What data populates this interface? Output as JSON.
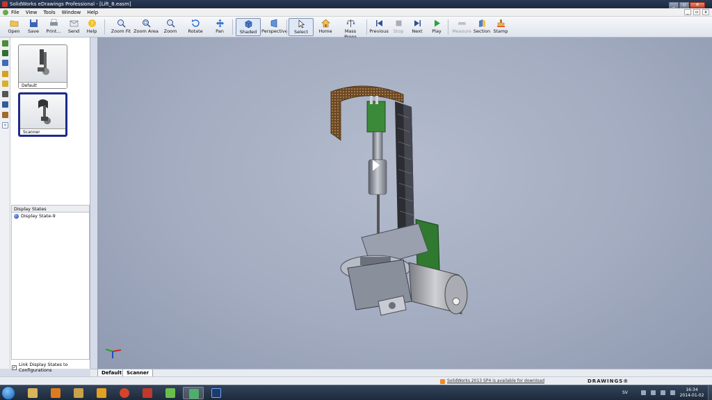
{
  "window": {
    "title": "SolidWorks eDrawings Professional - [Lift_8.easm]"
  },
  "menu": {
    "items": [
      "File",
      "View",
      "Tools",
      "Window",
      "Help"
    ]
  },
  "toolbar": {
    "buttons": [
      {
        "label": "Open",
        "icon": "folder-open-icon"
      },
      {
        "label": "Save",
        "icon": "floppy-disk-icon"
      },
      {
        "label": "Print...",
        "icon": "printer-icon"
      },
      {
        "label": "Send",
        "icon": "envelope-icon"
      },
      {
        "label": "Help",
        "icon": "help-icon"
      },
      {
        "label": "Zoom Fit",
        "icon": "zoom-fit-icon"
      },
      {
        "label": "Zoom Area",
        "icon": "zoom-area-icon"
      },
      {
        "label": "Zoom",
        "icon": "zoom-icon"
      },
      {
        "label": "Rotate",
        "icon": "rotate-icon"
      },
      {
        "label": "Pan",
        "icon": "pan-icon"
      },
      {
        "label": "Shaded",
        "icon": "shaded-cube-icon"
      },
      {
        "label": "Perspective",
        "icon": "perspective-icon"
      },
      {
        "label": "Select",
        "icon": "cursor-arrow-icon"
      },
      {
        "label": "Home",
        "icon": "home-icon"
      },
      {
        "label": "Mass Props",
        "icon": "mass-props-icon"
      },
      {
        "label": "Previous",
        "icon": "previous-icon"
      },
      {
        "label": "Stop",
        "icon": "stop-icon"
      },
      {
        "label": "Next",
        "icon": "next-icon"
      },
      {
        "label": "Play",
        "icon": "play-icon"
      },
      {
        "label": "Measure",
        "icon": "measure-icon"
      },
      {
        "label": "Section",
        "icon": "section-icon"
      },
      {
        "label": "Stamp",
        "icon": "stamp-icon"
      }
    ]
  },
  "configs": [
    {
      "label": "Default",
      "selected": false
    },
    {
      "label": "Scanner",
      "selected": true
    }
  ],
  "display_states": {
    "header": "Display States",
    "items": [
      "Display State-9"
    ],
    "link_label": "Link Display States to Configurations",
    "link_checked": true
  },
  "tabs": [
    "Default",
    "Scanner"
  ],
  "status": {
    "update_message": "SolidWorks 2013 SP4 is available for download",
    "brand": "DRAWINGS®"
  },
  "taskbar": {
    "apps": [
      "windows-explorer-icon",
      "media-player-icon",
      "file-manager-icon",
      "outlook-icon",
      "chrome-icon",
      "solidworks-icon",
      "notepad-icon",
      "edrawings-icon",
      "photoshop-icon"
    ],
    "language": "SV",
    "time": "16:34",
    "date": "2014-01-02"
  },
  "colors": {
    "title_bar": "#1c2a40",
    "viewport_bg": "#a3acc0",
    "selected_config_border": "#1f2a8a",
    "taskbar": "#1e2a3b"
  }
}
